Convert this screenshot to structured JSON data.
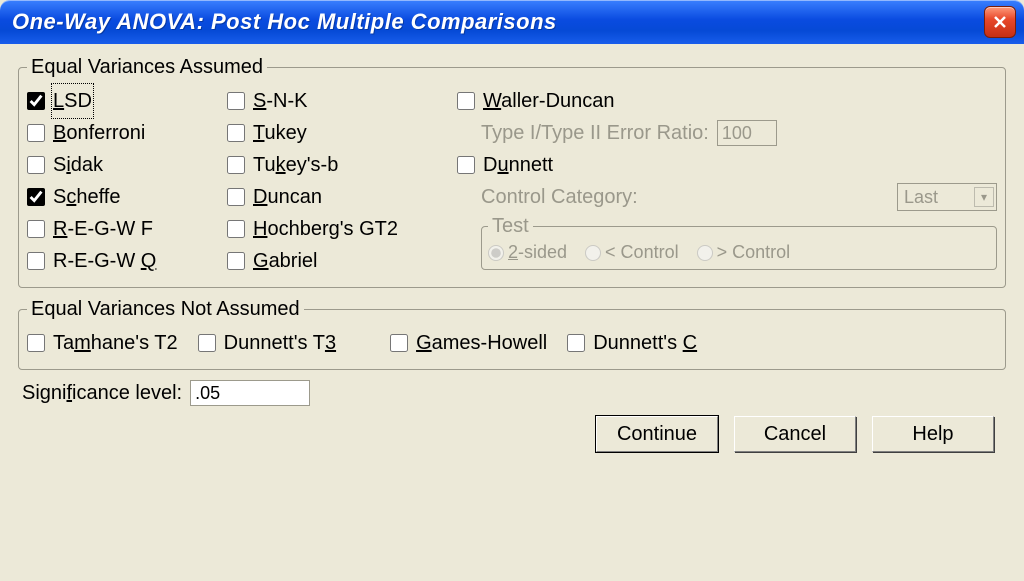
{
  "window": {
    "title": "One-Way ANOVA: Post Hoc Multiple Comparisons"
  },
  "group_equal": {
    "legend": "Equal Variances Assumed",
    "col1": {
      "lsd": {
        "html": "<u>L</u>SD",
        "checked": true,
        "focused": true
      },
      "bonferroni": {
        "html": "<u>B</u>onferroni",
        "checked": false
      },
      "sidak": {
        "html": "S<u>i</u>dak",
        "checked": false
      },
      "scheffe": {
        "html": "S<u>c</u>heffe",
        "checked": true
      },
      "regwf": {
        "html": "<u>R</u>-E-G-W F",
        "checked": false
      },
      "regwq": {
        "html": "R-E-G-W <u>Q</u>",
        "checked": false
      }
    },
    "col2": {
      "snk": {
        "html": "<u>S</u>-N-K",
        "checked": false
      },
      "tukey": {
        "html": "<u>T</u>ukey",
        "checked": false
      },
      "tukeysb": {
        "html": "Tu<u>k</u>ey's-b",
        "checked": false
      },
      "duncan": {
        "html": "<u>D</u>uncan",
        "checked": false
      },
      "hochberg": {
        "html": "<u>H</u>ochberg's GT2",
        "checked": false
      },
      "gabriel": {
        "html": "<u>G</u>abriel",
        "checked": false
      }
    },
    "col3": {
      "waller": {
        "html": "<u>W</u>aller-Duncan",
        "checked": false
      },
      "ratio_label": "Type I/Type II Error Ratio:",
      "ratio_value": "100",
      "dunnett": {
        "html": "D<u>u</u>nnett",
        "checked": false
      },
      "control_label": "Control Category:",
      "control_value": "Last",
      "test_legend": "Test",
      "test": {
        "two_sided": {
          "html": "<u>2</u>-sided",
          "selected": true
        },
        "lt_control": {
          "html": "< Control",
          "selected": false
        },
        "gt_control": {
          "html": "> Control",
          "selected": false
        }
      }
    }
  },
  "group_notequal": {
    "legend": "Equal Variances Not Assumed",
    "items": {
      "tamhane": {
        "html": "Ta<u>m</u>hane's T2",
        "checked": false
      },
      "dunnettt3": {
        "html": "Dunnett's T<u>3</u>",
        "checked": false
      },
      "games": {
        "html": "<u>G</u>ames-Howell",
        "checked": false
      },
      "dunnettc": {
        "html": "Dunnett's <u>C</u>",
        "checked": false
      }
    }
  },
  "significance": {
    "label_html": "Signi<u>f</u>icance level:",
    "value": ".05"
  },
  "buttons": {
    "continue": "Continue",
    "cancel": "Cancel",
    "help": "Help"
  }
}
